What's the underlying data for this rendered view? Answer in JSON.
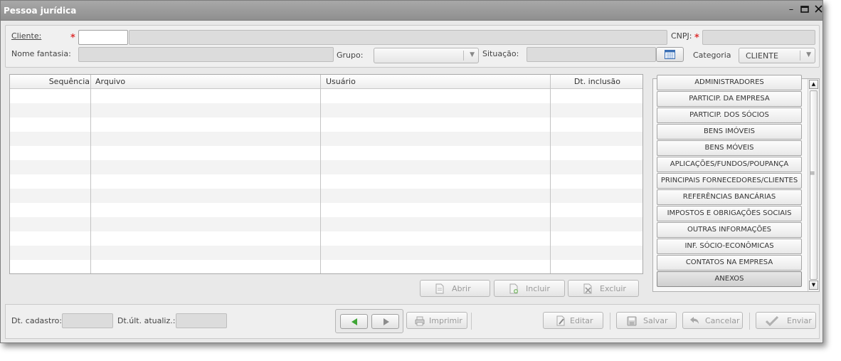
{
  "window": {
    "title": "Pessoa jurídica",
    "controls": [
      "minimize-icon",
      "maximize-icon",
      "close-icon"
    ]
  },
  "header": {
    "cliente_label": "Cliente:",
    "cliente_code": "",
    "cliente_name": "",
    "cnpj_label": "CNPJ:",
    "cnpj_value": "",
    "nome_fantasia_label": "Nome fantasia:",
    "nome_fantasia_value": "",
    "grupo_label": "Grupo:",
    "grupo_value": "",
    "situacao_label": "Situação:",
    "situacao_value": "",
    "categoria_label": "Categoria",
    "categoria_value": "CLIENTE",
    "required_marker": "*"
  },
  "grid": {
    "columns": [
      "Sequência",
      "Arquivo",
      "Usuário",
      "Dt. inclusão"
    ],
    "rows": []
  },
  "grid_actions": {
    "abrir": "Abrir",
    "incluir": "Incluir",
    "excluir": "Excluir"
  },
  "sections": [
    "ADMINISTRADORES",
    "PARTICIP. DA EMPRESA",
    "PARTICIP. DOS SÓCIOS",
    "BENS IMÓVEIS",
    "BENS MÓVEIS",
    "APLICAÇÕES/FUNDOS/POUPANÇA",
    "PRINCIPAIS FORNECEDORES/CLIENTES",
    "REFERÊNCIAS BANCÁRIAS",
    "IMPOSTOS E OBRIGAÇÕES SOCIAIS",
    "OUTRAS INFORMAÇÕES",
    "INF. SÓCIO-ECONÔMICAS",
    "CONTATOS NA EMPRESA",
    "ANEXOS"
  ],
  "active_section": "ANEXOS",
  "footer": {
    "dt_cadastro_label": "Dt. cadastro:",
    "dt_cadastro_value": "",
    "dt_ult_label": "Dt.últ. atualiz.:",
    "dt_ult_value": "",
    "imprimir": "Imprimir",
    "editar": "Editar",
    "salvar": "Salvar",
    "cancelar": "Cancelar",
    "enviar": "Enviar"
  },
  "colors": {
    "titlebar": "#9a9a9a",
    "required": "#dd3333",
    "nav_arrow": "#3fa535"
  }
}
